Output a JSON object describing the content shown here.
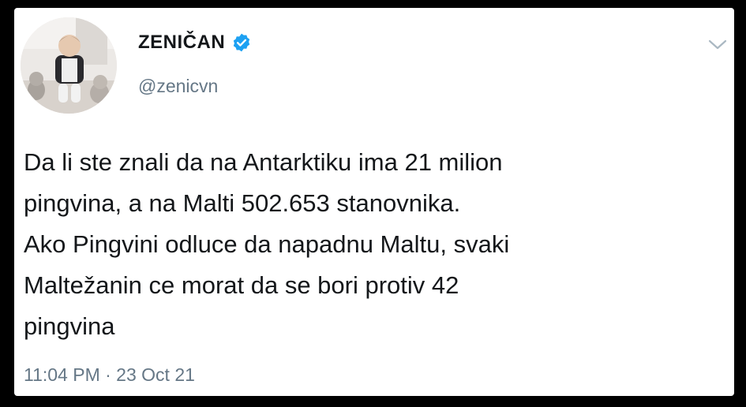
{
  "tweet": {
    "display_name": "ZENIČAN",
    "handle": "@zenicvn",
    "verified": true,
    "text": "Da li ste znali da na Antarktiku ima 21 milion\npingvina, a na Malti 502.653 stanovnika.\nAko Pingvini odluce da napadnu Maltu, svaki\nMaltežanin ce morat da se bori protiv 42\npingvina",
    "timestamp": "11:04 PM · 23 Oct 21",
    "icons": {
      "verified": "verified-badge-icon",
      "menu": "chevron-down-icon"
    },
    "colors": {
      "text": "#14171a",
      "secondary": "#657786",
      "verified": "#1da1f2",
      "background": "#ffffff",
      "frame": "#000000"
    }
  }
}
